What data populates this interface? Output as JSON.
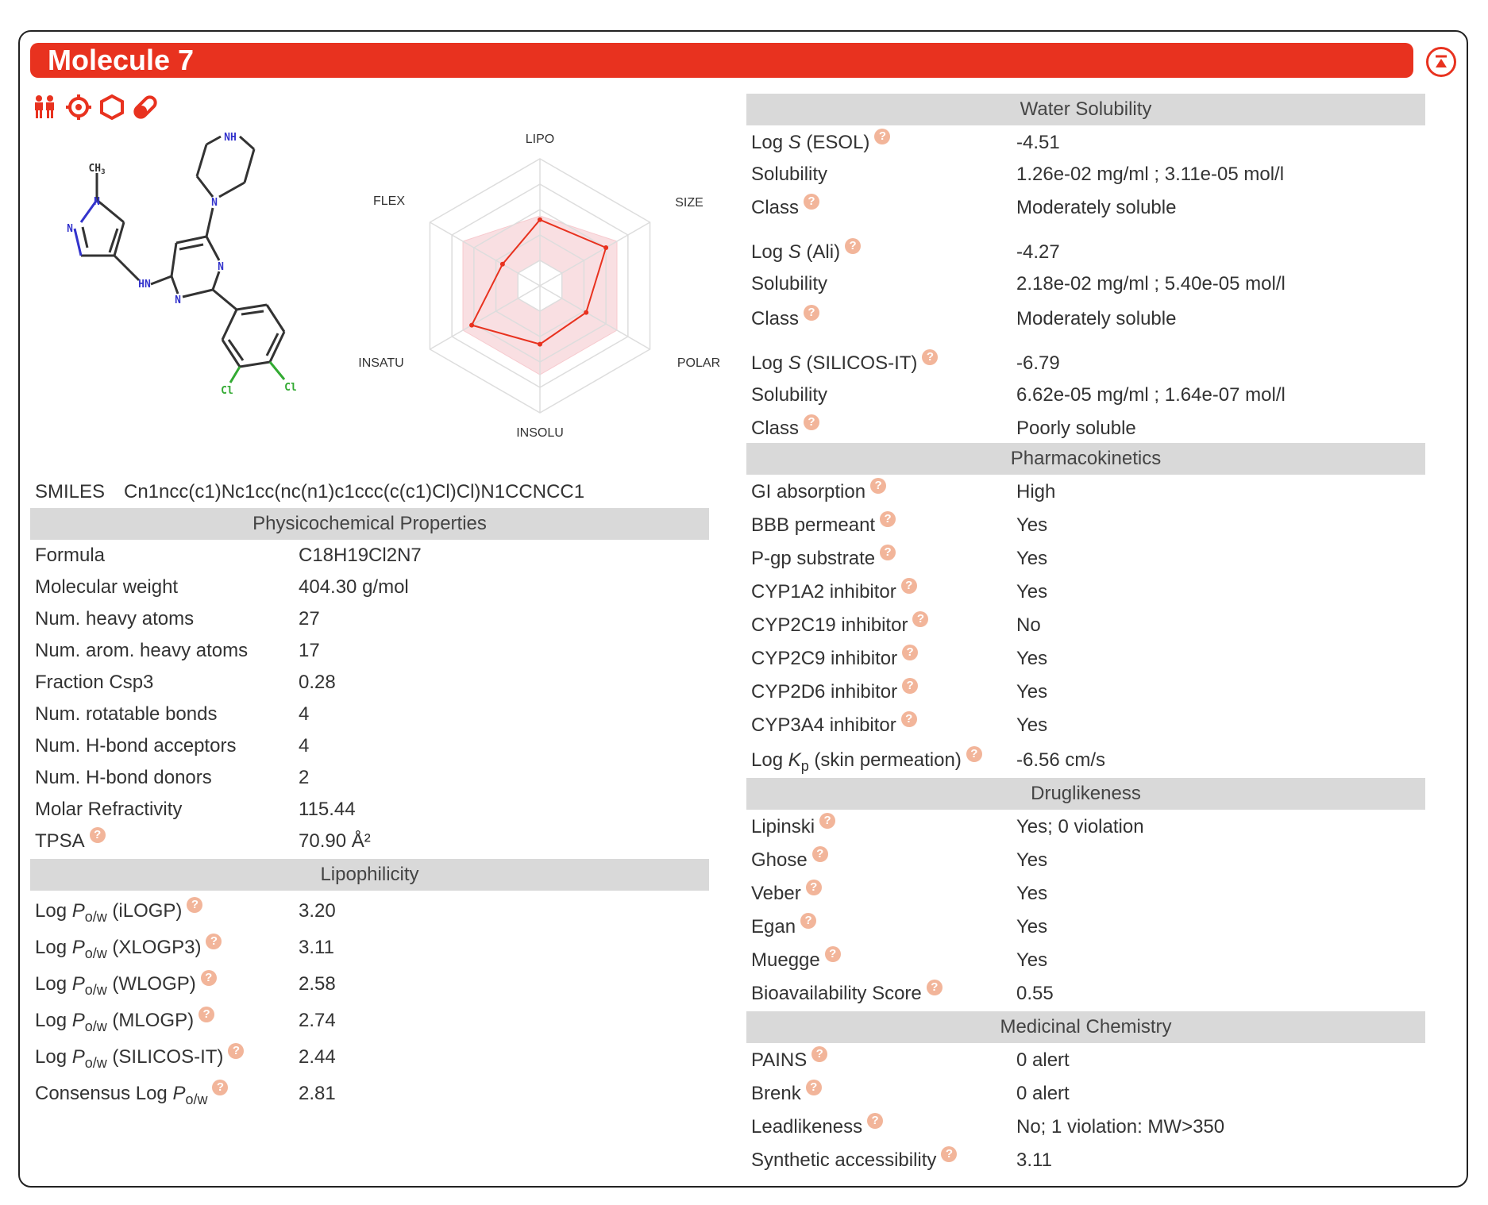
{
  "molecule": {
    "title": "Molecule 7"
  },
  "icons": [
    "people-icon",
    "target-icon",
    "hexagon-icon",
    "pill-icon"
  ],
  "radar": {
    "axes": [
      "LIPO",
      "SIZE",
      "POLAR",
      "INSOLU",
      "INSATU",
      "FLEX"
    ]
  },
  "smiles": {
    "label": "SMILES",
    "value": "Cn1ncc(c1)Nc1cc(nc(n1)c1ccc(c(c1)Cl)Cl)N1CCNCC1"
  },
  "physchem": {
    "header": "Physicochemical Properties",
    "rows": [
      {
        "label": "Formula",
        "value": "C18H19Cl2N7"
      },
      {
        "label": "Molecular weight",
        "value": "404.30 g/mol"
      },
      {
        "label": "Num. heavy atoms",
        "value": "27"
      },
      {
        "label": "Num. arom. heavy atoms",
        "value": "17"
      },
      {
        "label": "Fraction Csp3",
        "value": "0.28"
      },
      {
        "label": "Num. rotatable bonds",
        "value": "4"
      },
      {
        "label": "Num. H-bond acceptors",
        "value": "4"
      },
      {
        "label": "Num. H-bond donors",
        "value": "2"
      },
      {
        "label": "Molar Refractivity",
        "value": "115.44"
      },
      {
        "label": "TPSA",
        "value": "70.90 Å²"
      }
    ]
  },
  "lipo": {
    "header": "Lipophilicity",
    "log_prefix": "Log ",
    "p": "P",
    "ow": "o/w",
    "consensus_prefix": "Consensus Log ",
    "rows": [
      {
        "method": " (iLOGP)",
        "value": "3.20"
      },
      {
        "method": " (XLOGP3)",
        "value": "3.11"
      },
      {
        "method": " (WLOGP)",
        "value": "2.58"
      },
      {
        "method": " (MLOGP)",
        "value": "2.74"
      },
      {
        "method": " (SILICOS-IT)",
        "value": "2.44"
      }
    ],
    "consensus_value": "2.81"
  },
  "water": {
    "header": "Water Solubility",
    "log_prefix": "Log ",
    "s": "S",
    "solubility_label": "Solubility",
    "class_label": "Class",
    "groups": [
      {
        "method": " (ESOL)",
        "log": "-4.51",
        "solubility": "1.26e-02 mg/ml ; 3.11e-05 mol/l",
        "class": "Moderately soluble"
      },
      {
        "method": " (Ali)",
        "log": "-4.27",
        "solubility": "2.18e-02 mg/ml ; 5.40e-05 mol/l",
        "class": "Moderately soluble"
      },
      {
        "method": " (SILICOS-IT)",
        "log": "-6.79",
        "solubility": "6.62e-05 mg/ml ; 1.64e-07 mol/l",
        "class": "Poorly soluble"
      }
    ]
  },
  "pk": {
    "header": "Pharmacokinetics",
    "rows": [
      {
        "label": "GI absorption",
        "value": "High"
      },
      {
        "label": "BBB permeant",
        "value": "Yes"
      },
      {
        "label": "P-gp substrate",
        "value": "Yes"
      },
      {
        "label": "CYP1A2 inhibitor",
        "value": "Yes"
      },
      {
        "label": "CYP2C19 inhibitor",
        "value": "No"
      },
      {
        "label": "CYP2C9 inhibitor",
        "value": "Yes"
      },
      {
        "label": "CYP2D6 inhibitor",
        "value": "Yes"
      },
      {
        "label": "CYP3A4 inhibitor",
        "value": "Yes"
      }
    ],
    "kp_prefix": "Log ",
    "kp_k": "K",
    "kp_sub": "p",
    "kp_suffix": " (skin permeation)",
    "kp_value": "-6.56 cm/s"
  },
  "drug": {
    "header": "Druglikeness",
    "rows": [
      {
        "label": "Lipinski",
        "value": "Yes; 0 violation"
      },
      {
        "label": "Ghose",
        "value": "Yes"
      },
      {
        "label": "Veber",
        "value": "Yes"
      },
      {
        "label": "Egan",
        "value": "Yes"
      },
      {
        "label": "Muegge",
        "value": "Yes"
      },
      {
        "label": "Bioavailability Score",
        "value": "0.55"
      }
    ]
  },
  "medchem": {
    "header": "Medicinal Chemistry",
    "rows": [
      {
        "label": "PAINS",
        "value": "0 alert"
      },
      {
        "label": "Brenk",
        "value": "0 alert"
      },
      {
        "label": "Leadlikeness",
        "value": "No; 1 violation: MW>350"
      },
      {
        "label": "Synthetic accessibility",
        "value": "3.11"
      }
    ]
  },
  "structure_labels": {
    "ch3": "CH",
    "ch3_sub": "3",
    "n": "N",
    "nh": "NH",
    "hn": "HN",
    "cl": "Cl"
  },
  "colors": {
    "accent": "#e8321f",
    "header_bg": "#d9d9d9",
    "help": "#f2b59a",
    "bond": "#333333",
    "nitrogen": "#3333cc",
    "chlorine": "#33aa33"
  }
}
